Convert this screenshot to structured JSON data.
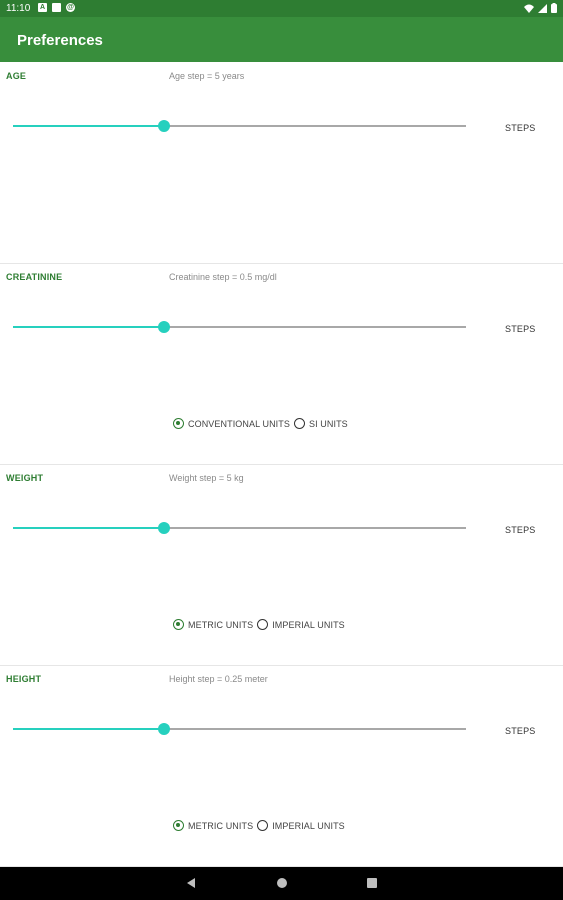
{
  "status_bar": {
    "time": "11:10",
    "left_icons": [
      "notification-a-icon",
      "sd-card-icon",
      "sync-icon"
    ],
    "right_icons": [
      "wifi-icon",
      "signal-icon",
      "battery-icon"
    ]
  },
  "app_bar": {
    "title": "Preferences"
  },
  "colors": {
    "primary_dark": "#2e7d32",
    "primary": "#388e3c",
    "accent": "#26d0be"
  },
  "sections": [
    {
      "title": "AGE",
      "subtitle": "Age step = 5 years",
      "slider_value": 0.333,
      "steps_label": "STEPS",
      "radio_options": []
    },
    {
      "title": "CREATININE",
      "subtitle": "Creatinine step = 0.5 mg/dl",
      "slider_value": 0.333,
      "steps_label": "STEPS",
      "radio_options": [
        {
          "label": "CONVENTIONAL UNITS",
          "checked": true
        },
        {
          "label": "SI UNITS",
          "checked": false
        }
      ]
    },
    {
      "title": "WEIGHT",
      "subtitle": "Weight step = 5 kg",
      "slider_value": 0.333,
      "steps_label": "STEPS",
      "radio_options": [
        {
          "label": "METRIC UNITS",
          "checked": true
        },
        {
          "label": "IMPERIAL UNITS",
          "checked": false
        }
      ]
    },
    {
      "title": "HEIGHT",
      "subtitle": "Height step = 0.25 meter",
      "slider_value": 0.333,
      "steps_label": "STEPS",
      "radio_options": [
        {
          "label": "METRIC UNITS",
          "checked": true
        },
        {
          "label": "IMPERIAL UNITS",
          "checked": false
        }
      ]
    }
  ],
  "nav_bar": {
    "buttons": [
      "back-icon",
      "home-icon",
      "recents-icon"
    ]
  }
}
